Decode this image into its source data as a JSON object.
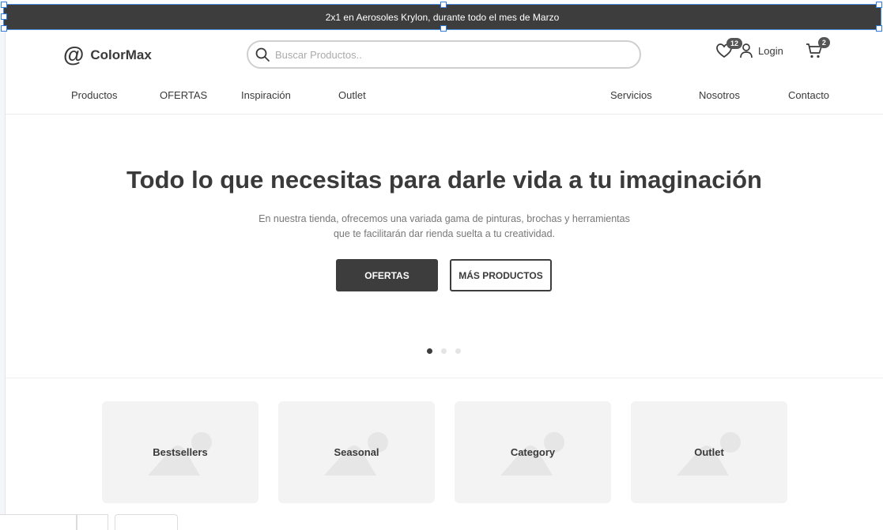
{
  "promo": {
    "text": "2x1 en Aerosoles Krylon, durante todo el mes de Marzo"
  },
  "brand": {
    "name": "ColorMax",
    "icon": "at-icon"
  },
  "search": {
    "placeholder": "Buscar Productos.."
  },
  "header": {
    "wishlist_count": "12",
    "login_label": "Login",
    "cart_count": "2"
  },
  "nav": {
    "left": [
      "Productos",
      "OFERTAS",
      "Inspiración",
      "Outlet"
    ],
    "right": [
      "Servicios",
      "Nosotros",
      "Contacto"
    ]
  },
  "hero": {
    "title": "Todo lo que necesitas para darle vida a tu imaginación",
    "subtitle": "En nuestra tienda, ofrecemos una variada gama de pinturas, brochas y herramientas que te facilitarán dar rienda suelta a tu creatividad.",
    "primary_button": "OFERTAS",
    "secondary_button": "MÁS PRODUCTOS",
    "slides": 3,
    "active_slide": 1
  },
  "categories": [
    "Bestsellers",
    "Seasonal",
    "Category",
    "Outlet"
  ],
  "colors": {
    "dark": "#3d3d3d",
    "card": "#f3f3f3",
    "selection": "#2f7bd9"
  }
}
